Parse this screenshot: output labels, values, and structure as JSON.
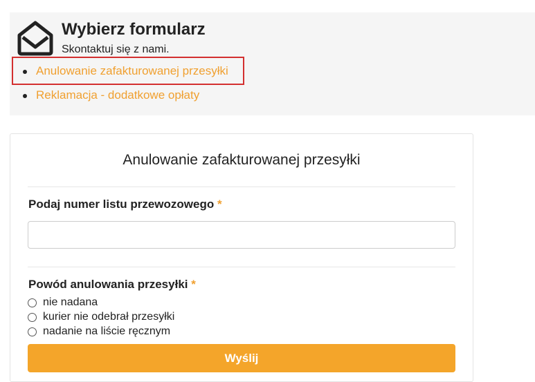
{
  "header": {
    "icon": "envelope-open-icon",
    "title": "Wybierz formularz",
    "subtitle": "Skontaktuj się z nami."
  },
  "forms_list": [
    {
      "label": "Anulowanie zafakturowanej przesyłki",
      "selected": true
    },
    {
      "label": "Reklamacja - dodatkowe opłaty",
      "selected": false
    }
  ],
  "form": {
    "title": "Anulowanie zafakturowanej przesyłki",
    "waybill": {
      "label": "Podaj numer listu przewozowego",
      "required_mark": "*",
      "value": ""
    },
    "reason": {
      "label": "Powód anulowania przesyłki",
      "required_mark": "*",
      "options": [
        {
          "label": "nie nadana",
          "checked": false
        },
        {
          "label": "kurier nie odebrał przesyłki",
          "checked": false
        },
        {
          "label": "nadanie na liście ręcznym",
          "checked": false
        }
      ]
    },
    "submit_label": "Wyślij"
  },
  "colors": {
    "accent": "#f4a52a",
    "link": "#f0a030",
    "highlight_border": "#d32f2f",
    "panel_bg": "#f5f5f5"
  }
}
